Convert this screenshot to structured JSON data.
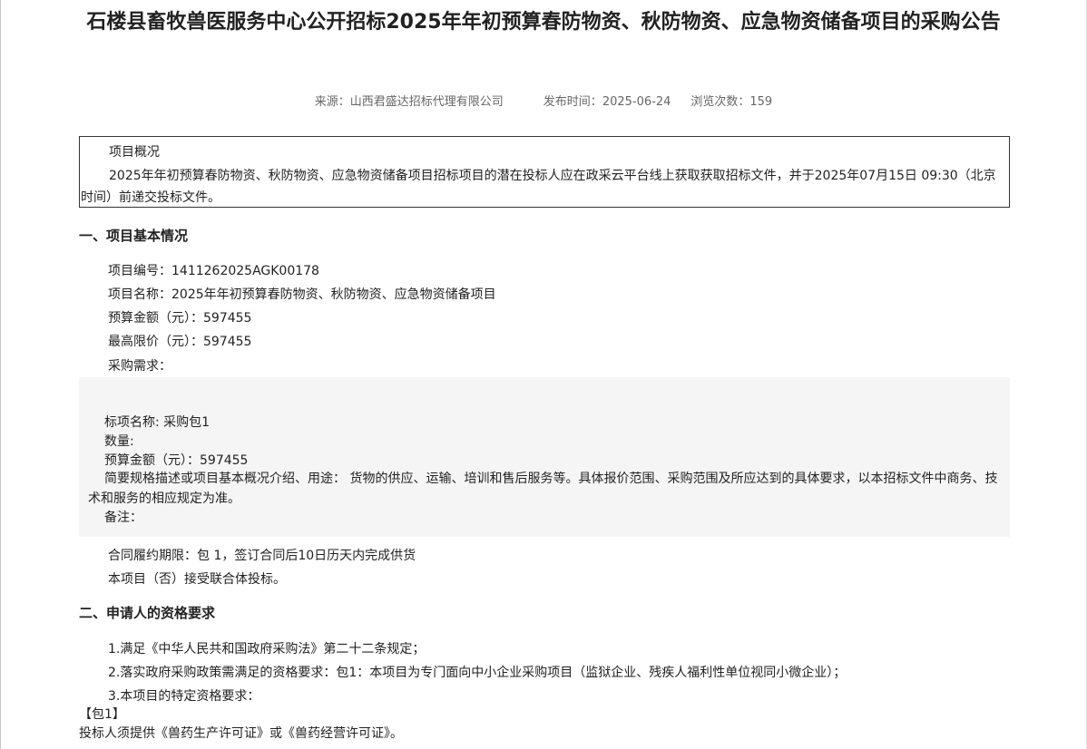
{
  "title": "石楼县畜牧兽医服务中心公开招标2025年年初预算春防物资、秋防物资、应急物资储备项目的采购公告",
  "meta": {
    "source_label": "来源：",
    "source": "山西君盛达招标代理有限公司",
    "date_label": "发布时间：",
    "date": "2025-06-24",
    "views_label": "浏览次数：",
    "views": "159"
  },
  "overview": {
    "heading": "项目概况",
    "text": "2025年年初预算春防物资、秋防物资、应急物资储备项目招标项目的潜在投标人应在政采云平台线上获取获取招标文件，并于2025年07月15日 09:30（北京时间）前递交投标文件。"
  },
  "section1": {
    "heading": "一、项目基本情况",
    "project_no": "项目编号：1411262025AGK00178",
    "project_name": "项目名称：2025年年初预算春防物资、秋防物资、应急物资储备项目",
    "budget": "预算金额（元）：597455",
    "max_price": "最高限价（元）：597455",
    "requirement_label": "采购需求：",
    "package": {
      "name": "标项名称: 采购包1",
      "quantity": "数量:",
      "budget": "预算金额（元）：597455",
      "description": "简要规格描述或项目基本概况介绍、用途： 货物的供应、运输、培训和售后服务等。具体报价范围、采购范围及所应达到的具体要求，以本招标文件中商务、技术和服务的相应规定为准。",
      "remark": "备注："
    },
    "contract_period": "合同履约期限：包 1，签订合同后10日历天内完成供货",
    "consortium": "本项目（否）接受联合体投标。"
  },
  "section2": {
    "heading": "二、申请人的资格要求",
    "req1": "1.满足《中华人民共和国政府采购法》第二十二条规定；",
    "req2": "2.落实政府采购政策需满足的资格要求：包1：本项目为专门面向中小企业采购项目（监狱企业、残疾人福利性单位视同小微企业）；",
    "req3": "3.本项目的特定资格要求：",
    "package_tag": "【包1】",
    "package_req": "投标人须提供《兽药生产许可证》或《兽药经营许可证》。"
  }
}
